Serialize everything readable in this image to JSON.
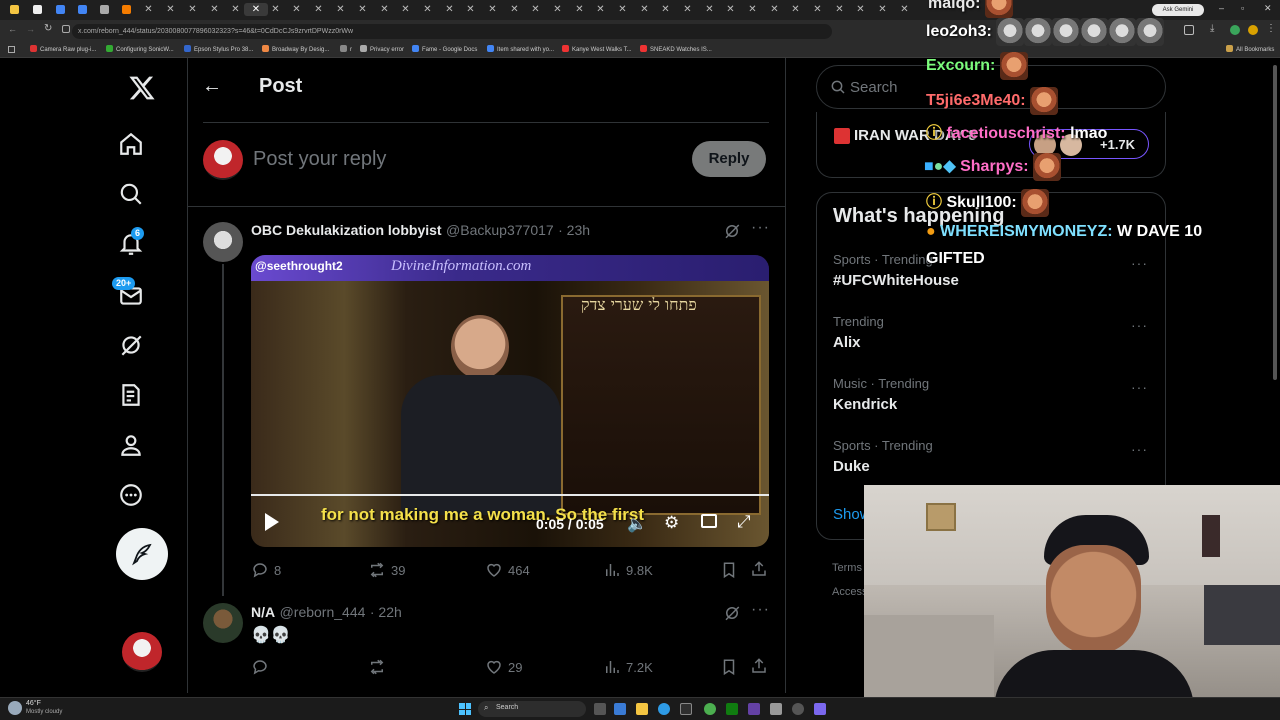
{
  "browser": {
    "url": "x.com/reborn_444/status/2030080077896032323?s=46&t=0CdDcCJs9zrvrtDPWzz0rWw",
    "bookmarks": [
      "Camera Raw plug-i...",
      "Configuring SonicW...",
      "Epson Stylus Pro 38...",
      "Broadway By Desig...",
      "r",
      "Privacy error",
      "Fame - Google Docs",
      "Item shared with yo...",
      "Kanye West Walks T...",
      "SNEAKD Watches IS...",
      "All Bookmarks"
    ],
    "ask_gemini": "Ask Gemini"
  },
  "nav": {
    "notifications_badge": "6",
    "messages_badge": "20+"
  },
  "header": {
    "title": "Post"
  },
  "reply_box": {
    "placeholder": "Post your reply",
    "reply_button": "Reply"
  },
  "post": {
    "author": "OBC Dekulakization lobbyist",
    "handle": "@Backup377017",
    "time": "· 23h",
    "video": {
      "watermark": "@seethrought2",
      "site": "DivineInformation.com",
      "subtitle": "for not making me a woman. So the first",
      "time": "0:05 / 0:05"
    },
    "stats": {
      "replies": "8",
      "reposts": "39",
      "likes": "464",
      "views": "9.8K"
    }
  },
  "reply": {
    "author": "N/A",
    "handle": "@reborn_444",
    "time": "· 22h",
    "body": "💀💀",
    "stats": {
      "likes": "29",
      "views": "7.2K"
    }
  },
  "right": {
    "search_placeholder": "Search",
    "live_event": "IRAN WAR DAY 8",
    "live_count": "+1.7K",
    "whats_happening": "What's happening",
    "trends": [
      {
        "category": "Sports · Trending",
        "name": "#UFCWhiteHouse"
      },
      {
        "category": "Trending",
        "name": "Alix"
      },
      {
        "category": "Music · Trending",
        "name": "Kendrick"
      },
      {
        "category": "Sports · Trending",
        "name": "Duke"
      }
    ],
    "show_more": "Show",
    "terms": "Terms",
    "access": "Access"
  },
  "chat": [
    {
      "user": "maiqo:",
      "color": "#e8e8e8",
      "text": ""
    },
    {
      "user": "leo2oh3:",
      "color": "#ffffff",
      "text": ""
    },
    {
      "user": "Excourn:",
      "color": "#7cfc7c",
      "text": ""
    },
    {
      "user": "T5ji6e3Me40:",
      "color": "#ff6b6b",
      "text": ""
    },
    {
      "user": "facetiouschrist:",
      "color": "#ff6ec7",
      "text": "lmao"
    },
    {
      "user": "Sharpys:",
      "color": "#ff6ec7",
      "text": ""
    },
    {
      "user": "Skull100:",
      "color": "#ffffff",
      "text": ""
    },
    {
      "user": "WHEREISMYMONEYZ:",
      "color": "#7fe0ff",
      "text": "W DAVE 10 GIFTED"
    }
  ],
  "taskbar": {
    "weather_temp": "46°F",
    "weather_desc": "Mostly cloudy",
    "search": "Search"
  },
  "colors": {
    "accent": "#1d9bf0",
    "background": "#000000",
    "border": "#2f3336",
    "muted": "#71767b"
  }
}
